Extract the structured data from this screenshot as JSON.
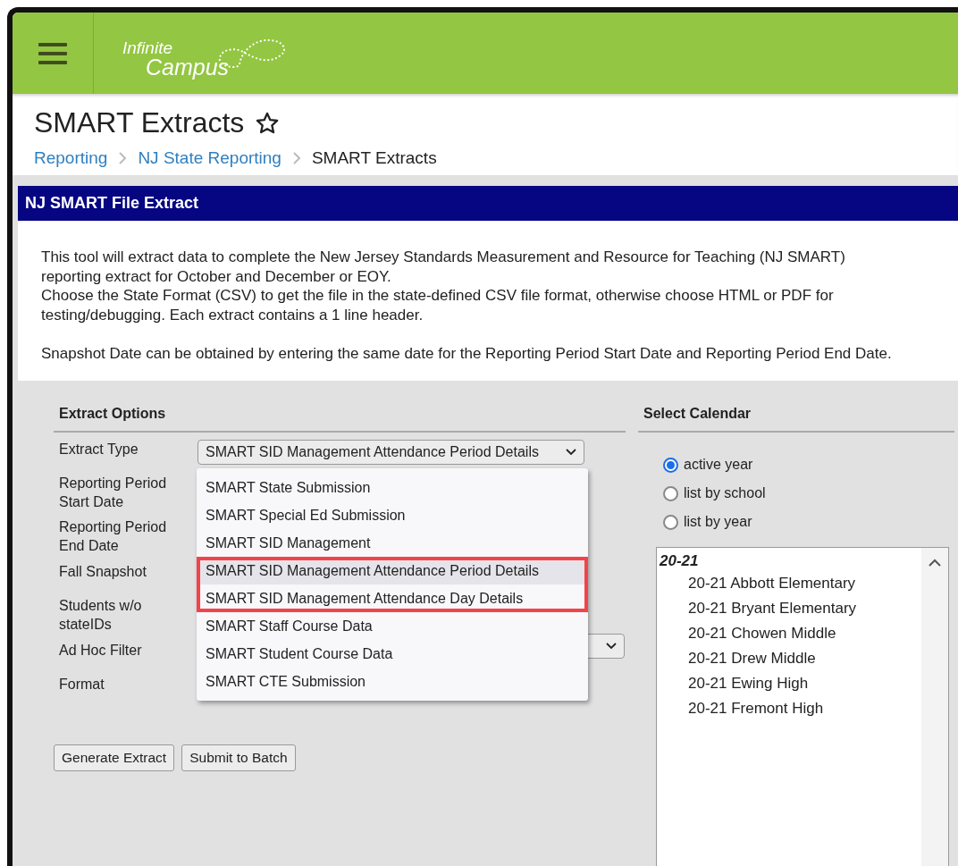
{
  "header": {
    "logo": {
      "line1": "Infinite",
      "line2": "Campus"
    }
  },
  "page": {
    "title": "SMART Extracts",
    "favorite": false,
    "breadcrumb": [
      {
        "label": "Reporting",
        "link": true
      },
      {
        "label": "NJ State Reporting",
        "link": true
      },
      {
        "label": "SMART Extracts",
        "link": false
      }
    ]
  },
  "panel": {
    "title": "NJ SMART File Extract",
    "description": [
      "This tool will extract data to complete the New Jersey Standards Measurement and Resource for Teaching (NJ SMART) reporting extract for October and December or EOY.",
      "Choose the State Format (CSV) to get the file in the state-defined CSV file format, otherwise choose HTML or PDF for testing/debugging. Each extract contains a 1 line header.",
      "Snapshot Date can be obtained by entering the same date for the Reporting Period Start Date and Reporting Period End Date."
    ]
  },
  "extract_options": {
    "title": "Extract Options",
    "fields": [
      {
        "label": "Extract Type",
        "kind": "select",
        "value": "SMART SID Management Attendance Period Details"
      },
      {
        "label": "Reporting Period Start Date",
        "kind": "hidden"
      },
      {
        "label": "Reporting Period End Date",
        "kind": "hidden"
      },
      {
        "label": "Fall Snapshot",
        "kind": "hidden"
      },
      {
        "label": "Students w/o stateIDs",
        "kind": "hidden"
      },
      {
        "label": "Ad Hoc Filter",
        "kind": "select_covered"
      },
      {
        "label": "Format",
        "kind": "hidden"
      }
    ],
    "dropdown": [
      {
        "label": "SMART State Submission",
        "selected": false,
        "boxed": false
      },
      {
        "label": "SMART Special Ed Submission",
        "selected": false,
        "boxed": false
      },
      {
        "label": "SMART SID Management",
        "selected": false,
        "boxed": false
      },
      {
        "label": "SMART SID Management Attendance Period Details",
        "selected": true,
        "boxed": true
      },
      {
        "label": "SMART SID Management Attendance Day Details",
        "selected": false,
        "boxed": true
      },
      {
        "label": "SMART Staff Course Data",
        "selected": false,
        "boxed": false
      },
      {
        "label": "SMART Student Course Data",
        "selected": false,
        "boxed": false
      },
      {
        "label": "SMART CTE Submission",
        "selected": false,
        "boxed": false
      }
    ],
    "buttons": [
      "Generate Extract",
      "Submit to Batch"
    ]
  },
  "select_calendar": {
    "title": "Select Calendar",
    "options": [
      {
        "label": "active year",
        "selected": true
      },
      {
        "label": "list by school",
        "selected": false
      },
      {
        "label": "list by year",
        "selected": false
      }
    ],
    "list": [
      {
        "label": "20-21",
        "children": [
          {
            "label": "20-21 Abbott Elementary"
          },
          {
            "label": "20-21 Bryant Elementary"
          },
          {
            "label": "20-21 Chowen Middle"
          },
          {
            "label": "20-21 Drew Middle"
          },
          {
            "label": "20-21 Ewing High"
          },
          {
            "label": "20-21 Fremont High"
          }
        ]
      }
    ]
  }
}
